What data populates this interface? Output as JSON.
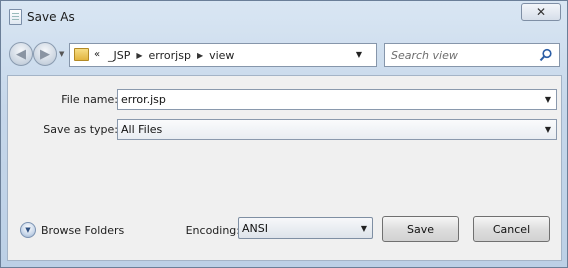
{
  "window": {
    "title": "Save As",
    "close_glyph": "✕"
  },
  "navigation": {
    "back_icon": "back-arrow-icon",
    "forward_icon": "forward-arrow-icon",
    "address": {
      "lead": "«",
      "crumbs": [
        "_JSP",
        "errorjsp",
        "view"
      ]
    },
    "search_placeholder": "Search view"
  },
  "form": {
    "file_name_label": "File name:",
    "file_name_value": "error.jsp",
    "save_type_label": "Save as type:",
    "save_type_value": "All Files"
  },
  "footer": {
    "browse_label": "Browse Folders",
    "encoding_label": "Encoding:",
    "encoding_value": "ANSI",
    "save_label": "Save",
    "cancel_label": "Cancel"
  },
  "icons": {
    "folder": "folder-icon",
    "search": "search-icon",
    "refresh": "refresh-icon",
    "browse": "chevron-down-circle-icon"
  }
}
